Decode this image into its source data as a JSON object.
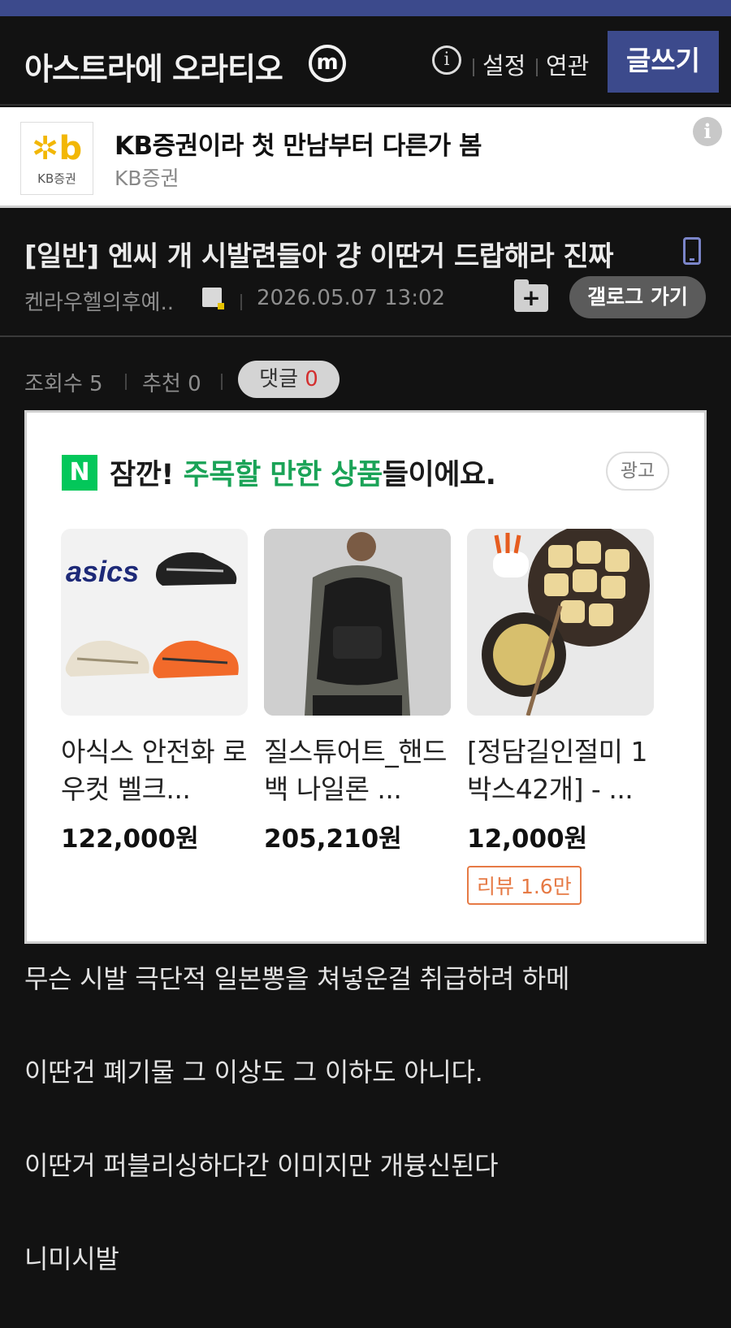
{
  "header": {
    "title": "아스트라에 오라티오",
    "minor_badge": "m",
    "info_icon": "i",
    "nav_settings": "설정",
    "nav_related": "연관",
    "write_label": "글쓰기"
  },
  "ad_banner": {
    "logo_mark": "✲b",
    "logo_text": "KB증권",
    "title": "KB증권이라 첫 만남부터 다른가 봄",
    "advertiser": "KB증권",
    "info_icon": "i"
  },
  "post": {
    "title": "[일반] 엔씨 개 시발련들아 걍 이딴거 드랍해라 진짜",
    "author": "켄라우헬의후예..",
    "date": "2026.05.07 13:02",
    "folder_plus": "+",
    "gallog_label": "갤로그 가기"
  },
  "stats": {
    "views": "조회수 5",
    "recommend": "추천 0",
    "comment_label": "댓글",
    "comment_count": "0"
  },
  "ad_box": {
    "n_logo": "N",
    "head_prefix": "잠깐! ",
    "head_highlight": "주목할 만한 상품",
    "head_suffix": "들이에요.",
    "ad_label": "광고",
    "products": [
      {
        "name": "아식스 안전화 로우컷 벨크...",
        "price": "122,000원",
        "brand_text": "asics"
      },
      {
        "name": "질스튜어트_핸드백 나일론 ...",
        "price": "205,210원"
      },
      {
        "name": "[정담길인절미 1박스42개] - ...",
        "price": "12,000원",
        "review": "리뷰 1.6만"
      }
    ]
  },
  "body": {
    "lines": [
      "무슨 시발 극단적 일본뽕을 쳐넣운걸 취급하려 하메",
      "이딴건 폐기물 그 이상도 그 이하도 아니다.",
      "이딴거 퍼블리싱하다간 이미지만 개븅신된다",
      "니미시발"
    ]
  },
  "colors": {
    "accent": "#3c4a8c",
    "naver_green": "#03c75a",
    "highlight_green": "#1aa357",
    "review_orange": "#e67a45",
    "comment_red": "#d32f2f"
  }
}
